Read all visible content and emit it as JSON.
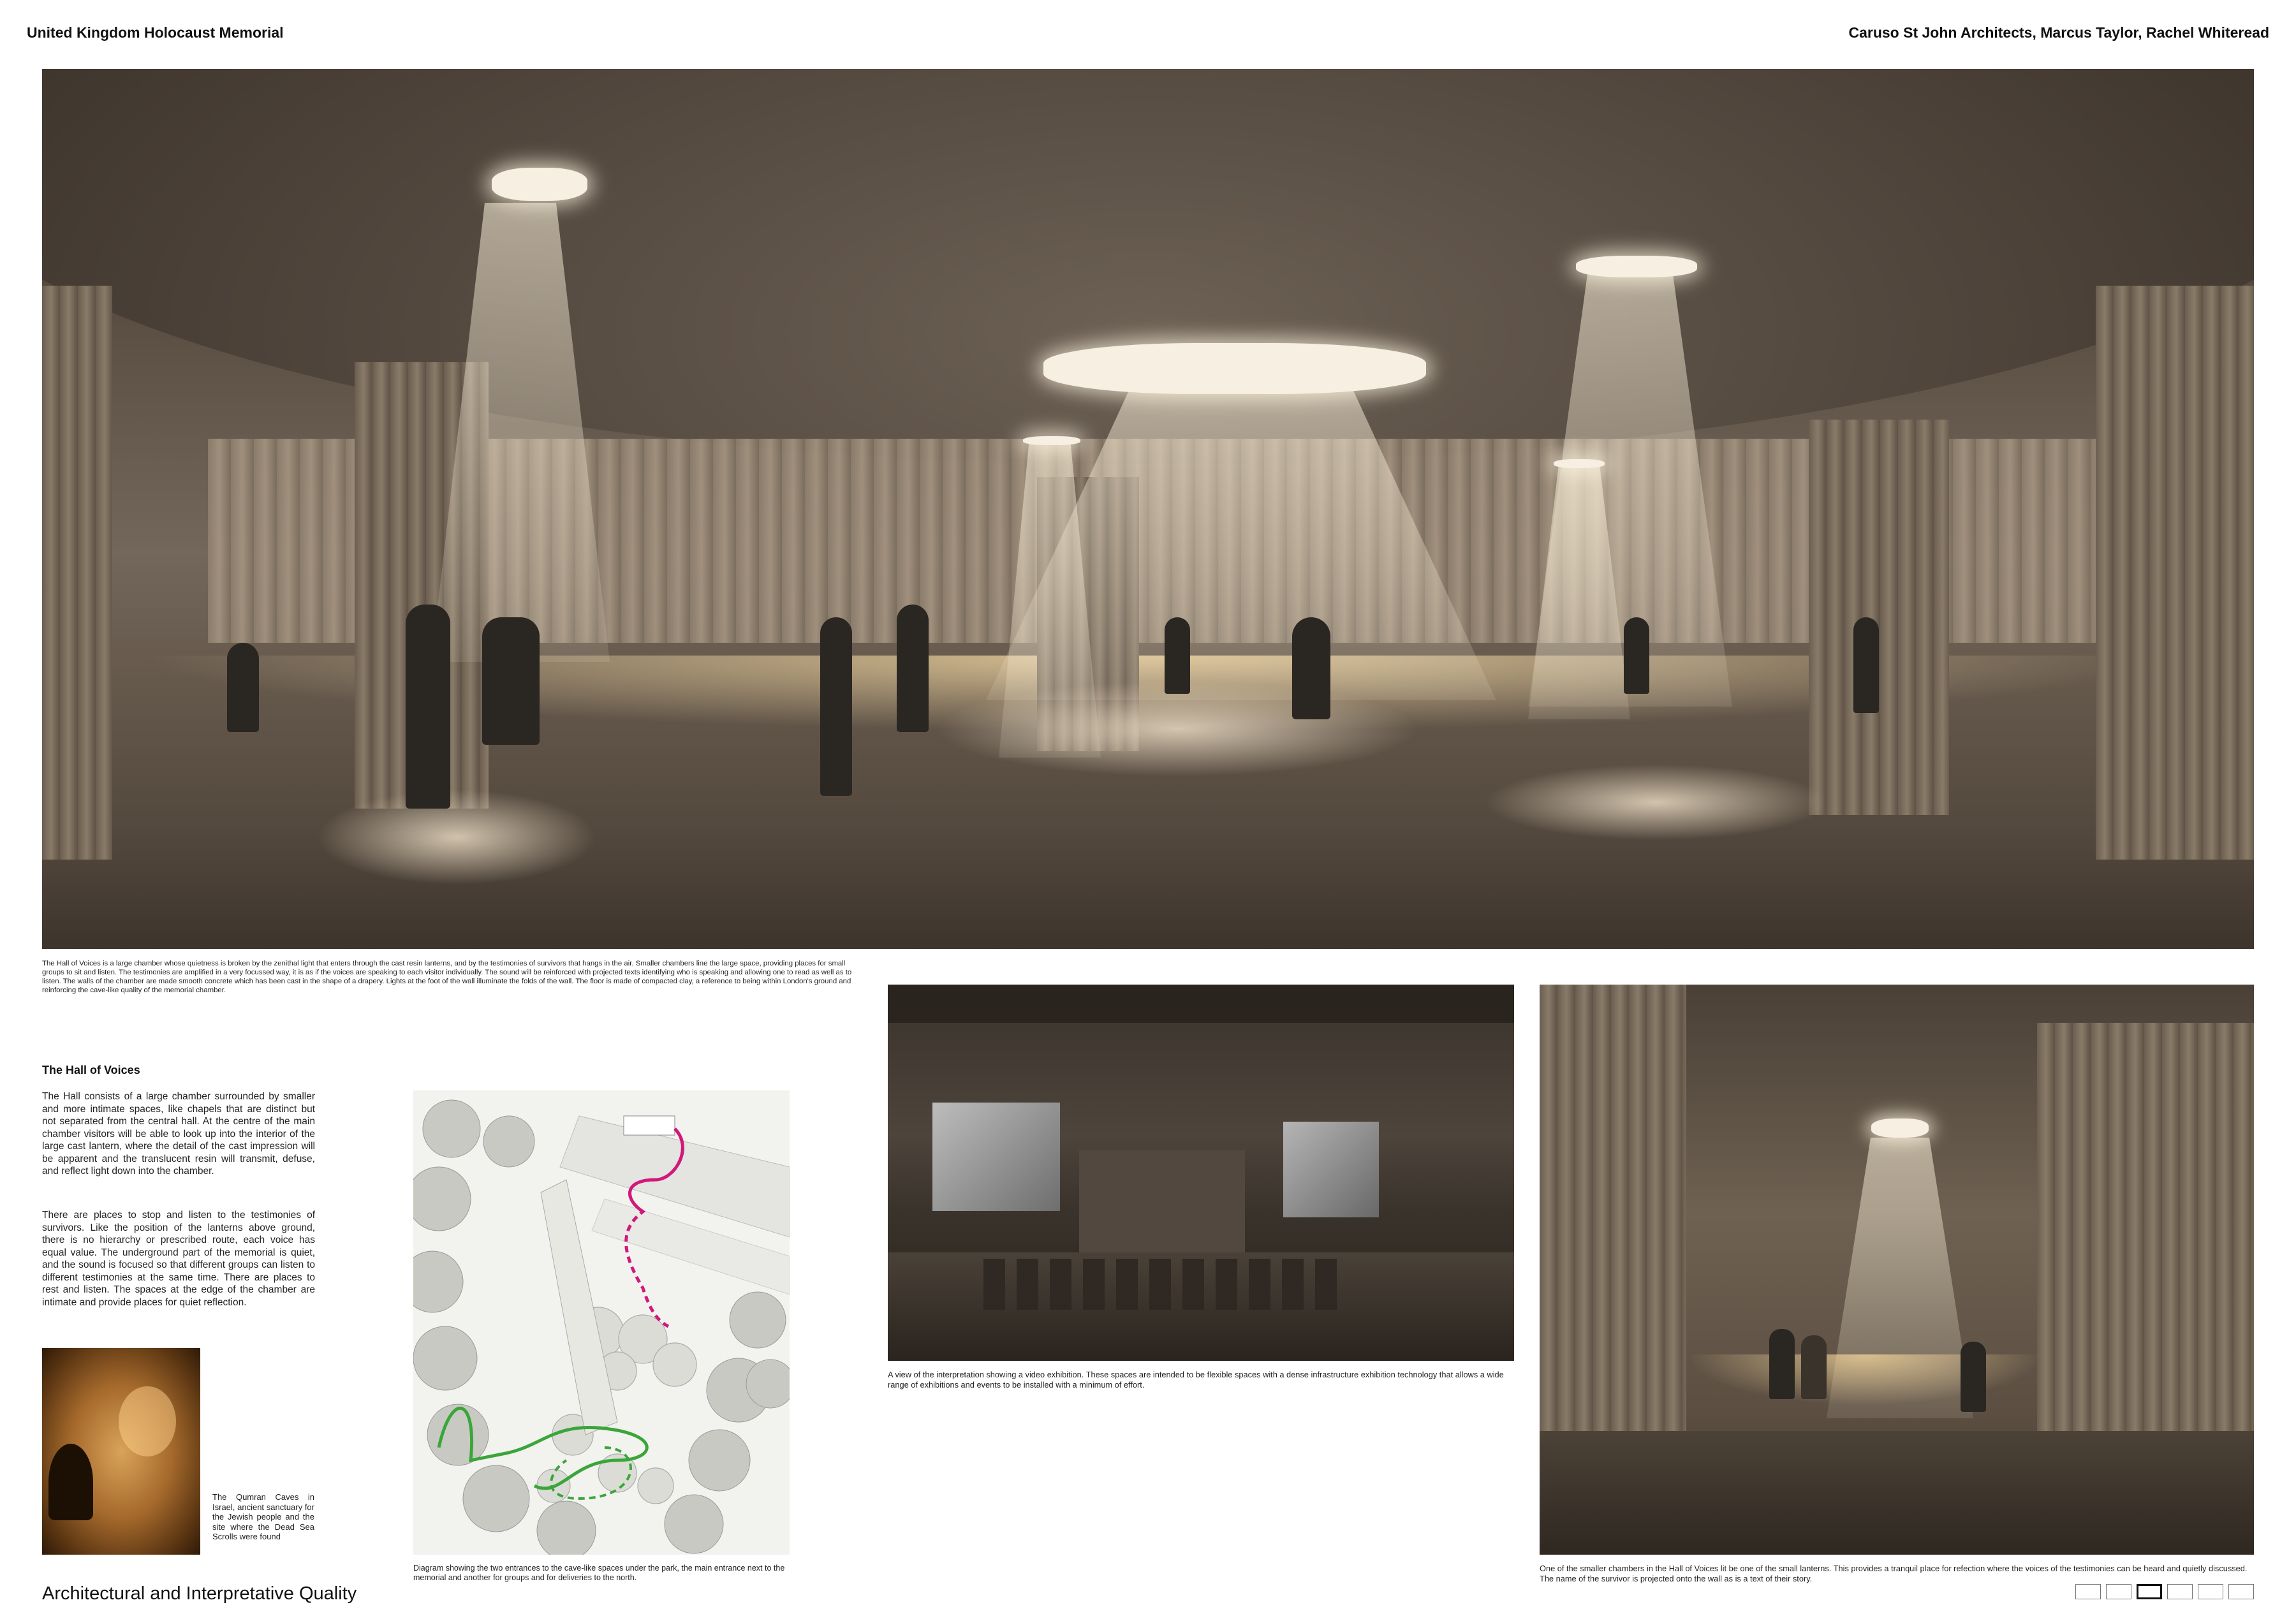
{
  "header": {
    "project_title": "United Kingdom Holocaust Memorial",
    "team": "Caruso St John Architects, Marcus Taylor, Rachel Whiteread"
  },
  "main_render": {
    "caption": "The Hall of Voices is a large chamber whose quietness is broken by the zenithal light that enters through the cast resin lanterns, and by the testimonies of survivors that hangs in the air. Smaller chambers line the large space, providing places for small groups to sit and listen. The testimonies are amplified in a very focussed way, it is as if the voices are speaking to each visitor individually. The sound will be reinforced with projected texts identifying who is speaking and allowing one to read as well as to listen. The walls of the chamber are made smooth concrete which has been cast in the shape of a drapery. Lights at the foot of the wall illuminate the folds of the wall. The floor is made of compacted clay, a reference to being within London's ground and reinforcing the cave-like quality of the memorial chamber."
  },
  "hall_of_voices": {
    "title": "The Hall of Voices",
    "paragraph_1": "The Hall consists of a large chamber surrounded by smaller and more intimate spaces, like chapels that are distinct but not separated from the central hall. At the centre of the main chamber visitors will be able to look up into the interior of the large cast lantern, where the detail of the cast impression will be apparent and the translucent resin will transmit, defuse, and reflect light down into the chamber.",
    "paragraph_2": "There are places to stop and listen to the testimonies of survivors. Like the position of the lanterns above ground, there is no hierarchy or prescribed route, each voice has equal value. The underground part of the memorial is quiet, and the sound is focused so that different groups can listen to different testimonies at the same time. There are places to rest and listen. The spaces at the edge of the chamber are intimate and provide places for quiet reflection."
  },
  "cave_image": {
    "caption": "The Qumran Caves in Israel, ancient sanctuary for the Jewish people and the site where the Dead Sea Scrolls were found"
  },
  "diagram": {
    "caption": "Diagram showing the two entrances to the cave-like spaces under the park, the main entrance next to the memorial and another for groups and for deliveries to the north.",
    "colors": {
      "main_route": "#3aa63a",
      "group_route": "#d1197a"
    }
  },
  "video_image": {
    "caption": "A view of the interpretation showing a video exhibition. These spaces are intended to be flexible spaces with a dense infrastructure exhibition technology that allows a wide range of exhibitions and events to be installed with a minimum of effort."
  },
  "chamber_image": {
    "caption": "One of the smaller chambers in the Hall of Voices lit be one of the small lanterns. This provides a tranquil place for refection where the voices of the testimonies can be heard and quietly discussed. The name of the survivor is projected onto the wall as is a text of their story."
  },
  "footer": {
    "section_title": "Architectural and Interpretative Quality",
    "pages": [
      "1",
      "2",
      "3",
      "4",
      "5",
      "6"
    ],
    "active_page": "3"
  }
}
